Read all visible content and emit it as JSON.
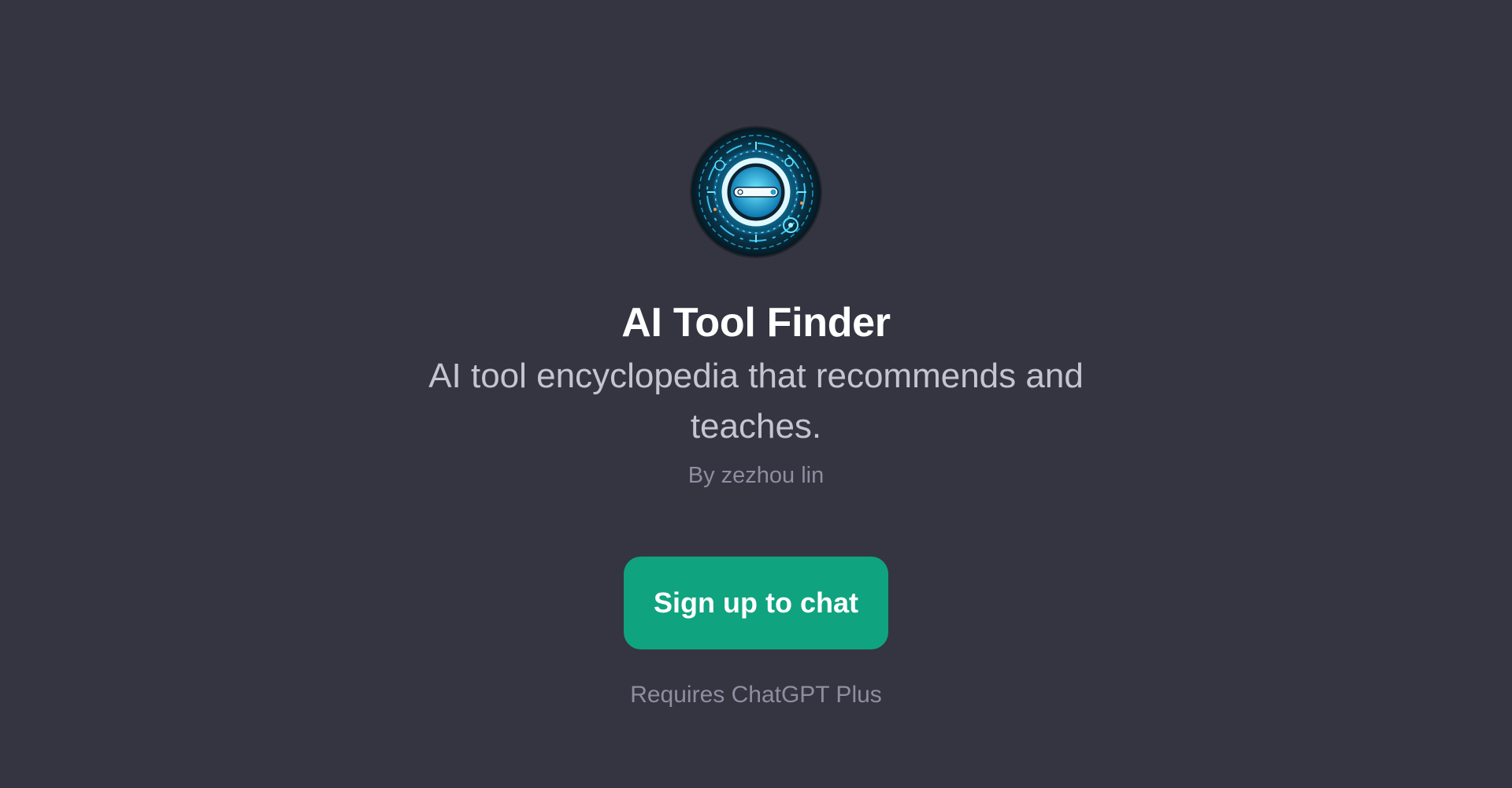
{
  "gpt": {
    "avatar_icon": "ai-search-dial-icon",
    "title": "AI Tool Finder",
    "description": "AI tool encyclopedia that recommends and teaches.",
    "author": "By zezhou lin"
  },
  "cta": {
    "label": "Sign up to chat"
  },
  "footer": {
    "requires": "Requires ChatGPT Plus"
  },
  "colors": {
    "background": "#343541",
    "accent": "#10a37f",
    "title": "#ffffff",
    "description": "#c5c5d2",
    "muted": "#8e8ea0"
  }
}
